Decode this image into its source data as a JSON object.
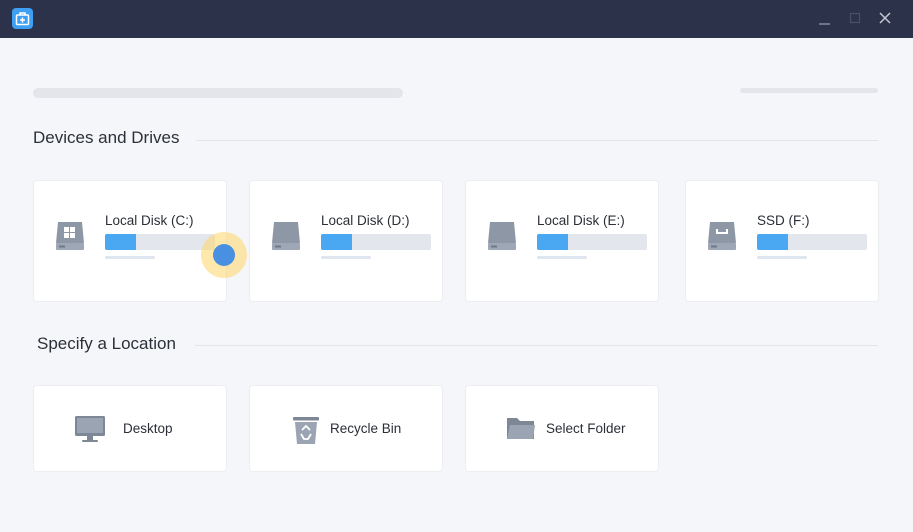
{
  "sections": {
    "devices_title": "Devices and Drives",
    "location_title": "Specify a Location"
  },
  "drives": [
    {
      "name": "Local Disk (C:)",
      "used_fraction": 0.28,
      "icon": "windows-drive-icon"
    },
    {
      "name": "Local Disk (D:)",
      "used_fraction": 0.28,
      "icon": "hard-drive-icon"
    },
    {
      "name": "Local Disk (E:)",
      "used_fraction": 0.28,
      "icon": "hard-drive-icon"
    },
    {
      "name": "SSD (F:)",
      "used_fraction": 0.28,
      "icon": "ssd-drive-icon"
    }
  ],
  "locations": [
    {
      "label": "Desktop",
      "icon": "monitor-icon"
    },
    {
      "label": "Recycle Bin",
      "icon": "recycle-bin-icon"
    },
    {
      "label": "Select Folder",
      "icon": "folder-icon"
    }
  ],
  "colors": {
    "titlebar": "#2b3249",
    "accent": "#4aa8f2",
    "background": "#f5f6fa"
  }
}
